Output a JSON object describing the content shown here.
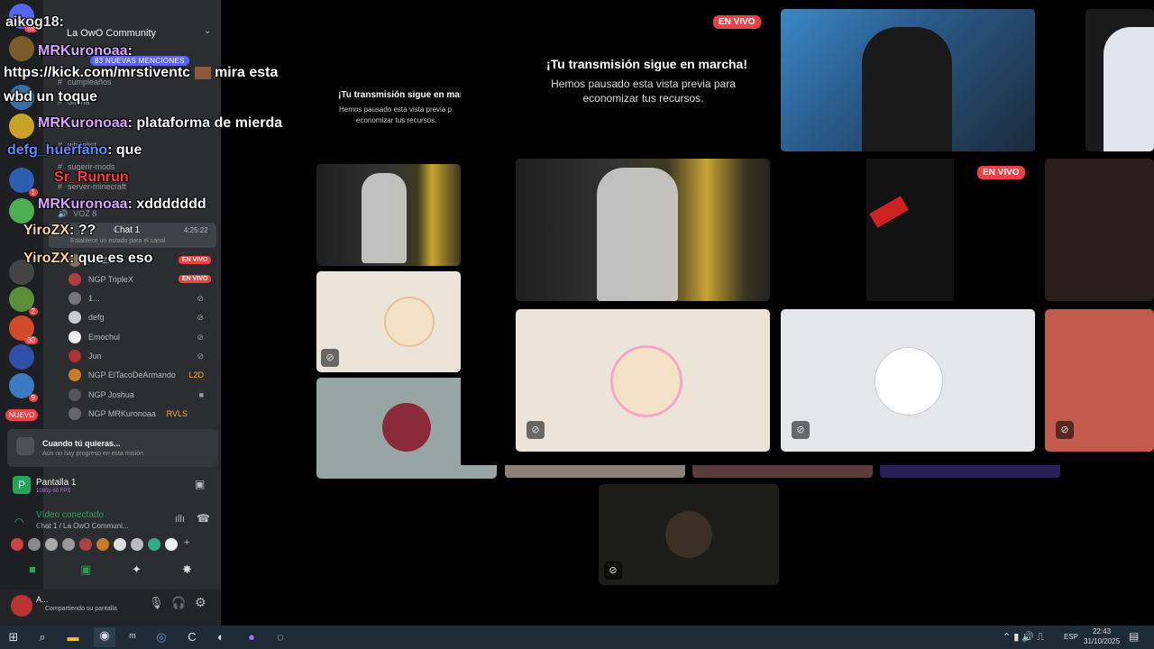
{
  "server": {
    "name": "La OwO Community",
    "mentions_pill": "83 NUEVAS MENCIONES",
    "new_label": "NUEVO"
  },
  "server_badges": [
    "59",
    "1",
    "2",
    "30",
    "9"
  ],
  "channels": [
    "cumpleaños",
    "ditoria",
    "whitelist",
    "sugerir-mods",
    "server-minecraft",
    "VOZ 8"
  ],
  "active_voice_channel": {
    "name": "ℂhat 1",
    "time": "4:25:22",
    "status_prompt": "Establece un estado para el canal"
  },
  "voice_users": [
    {
      "name": "YiroZX",
      "live": "EN VIVO"
    },
    {
      "name": "NGP TripleX",
      "live": "EN VIVO"
    },
    {
      "name": "1..."
    },
    {
      "name": "defg"
    },
    {
      "name": "Emochul"
    },
    {
      "name": "Jun"
    },
    {
      "name": "NGP ElTacoDeArmando",
      "tag": "L2D"
    },
    {
      "name": "NGP Joshua"
    },
    {
      "name": "NGP MRKuronoaa",
      "tag": "RVLS"
    }
  ],
  "quest": {
    "title": "Cuando tú quieras...",
    "subtitle": "Aún no hay progreso en esta misión"
  },
  "screen_share": {
    "title": "Pantalla 1",
    "quality": "1080p 60 FPS"
  },
  "voice_panel": {
    "status": "Vídeo conectado",
    "channel": "ℂhat 1 / La OwO Communi..."
  },
  "user_panel": {
    "name": "A...",
    "status": "Compartiendo su pantalla"
  },
  "chat": [
    {
      "user": "aikog18",
      "text": ":",
      "color": "#e6e6e6"
    },
    {
      "user": "MRKuronoaa",
      "text": ":",
      "color": "#d6a4ff"
    },
    {
      "user": "",
      "text": "https://kick.com/mrstiventc",
      "extra": "mira esta",
      "color": "#ffffff"
    },
    {
      "user": "",
      "text": "wbd un toque",
      "color": "#ffffff"
    },
    {
      "user": "MRKuronoaa",
      "text": ": plataforma de mierda",
      "color": "#d6a4ff"
    },
    {
      "user": "defg_huerfano",
      "text": ": que",
      "color": "#5b8bff"
    },
    {
      "user": "Sr_Runrun",
      "text": "",
      "color": "#ff3b3b"
    },
    {
      "user": "MRKuronoaa",
      "text": ": xddddddd",
      "color": "#d6a4ff"
    },
    {
      "user": "YiroZX",
      "text": ": ??",
      "color": "#ffd6a0"
    },
    {
      "user": "YiroZX",
      "text": ": que es eso",
      "color": "#ffd6a0"
    }
  ],
  "paused": {
    "title": "¡Tu transmisión sigue en marcha!",
    "body": "Hemos pausado esta vista previa para economizar tus recursos.",
    "title_small": "¡Tu transmisión sigue en marc",
    "body_small_1": "Hemos pausado esta vista previa p",
    "body_small_2": "economizar tus recursos."
  },
  "live_badge": "EN VIVO",
  "taskbar": {
    "lang": "ESP",
    "time": "22:43",
    "date": "31/10/2025"
  }
}
